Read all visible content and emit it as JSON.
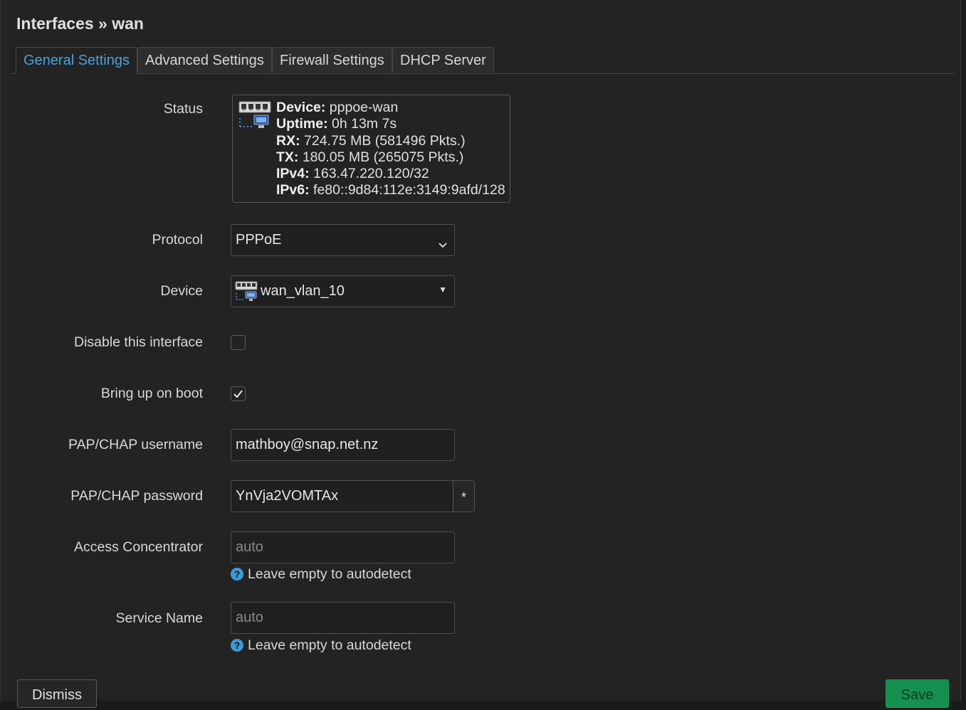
{
  "header": {
    "title": "Interfaces » wan"
  },
  "tabs": [
    {
      "label": "General Settings",
      "active": true
    },
    {
      "label": "Advanced Settings",
      "active": false
    },
    {
      "label": "Firewall Settings",
      "active": false
    },
    {
      "label": "DHCP Server",
      "active": false
    }
  ],
  "status": {
    "label": "Status",
    "icon": "network-device-icon",
    "lines": [
      {
        "key": "Device:",
        "value": " pppoe-wan"
      },
      {
        "key": "Uptime:",
        "value": " 0h 13m 7s"
      },
      {
        "key": "RX:",
        "value": " 724.75 MB (581496 Pkts.)"
      },
      {
        "key": "TX:",
        "value": " 180.05 MB (265075 Pkts.)"
      },
      {
        "key": "IPv4:",
        "value": " 163.47.220.120/32"
      },
      {
        "key": "IPv6:",
        "value": " fe80::9d84:112e:3149:9afd/128"
      }
    ]
  },
  "form": {
    "protocol": {
      "label": "Protocol",
      "value": "PPPoE"
    },
    "device": {
      "label": "Device",
      "value": "wan_vlan_10",
      "icon": "ethernet-port-icon"
    },
    "disable_interface": {
      "label": "Disable this interface",
      "checked": false
    },
    "bring_up_on_boot": {
      "label": "Bring up on boot",
      "checked": true
    },
    "username": {
      "label": "PAP/CHAP username",
      "value": "mathboy@snap.net.nz"
    },
    "password": {
      "label": "PAP/CHAP password",
      "value": "YnVja2VOMTAx",
      "toggle": "*"
    },
    "access_concentrator": {
      "label": "Access Concentrator",
      "placeholder": "auto",
      "hint": "Leave empty to autodetect"
    },
    "service_name": {
      "label": "Service Name",
      "placeholder": "auto",
      "hint": "Leave empty to autodetect"
    }
  },
  "footer": {
    "dismiss_label": "Dismiss",
    "save_label": "Save"
  },
  "colors": {
    "accent": "#4aa3d8",
    "save": "#14904f",
    "background": "#232323"
  }
}
